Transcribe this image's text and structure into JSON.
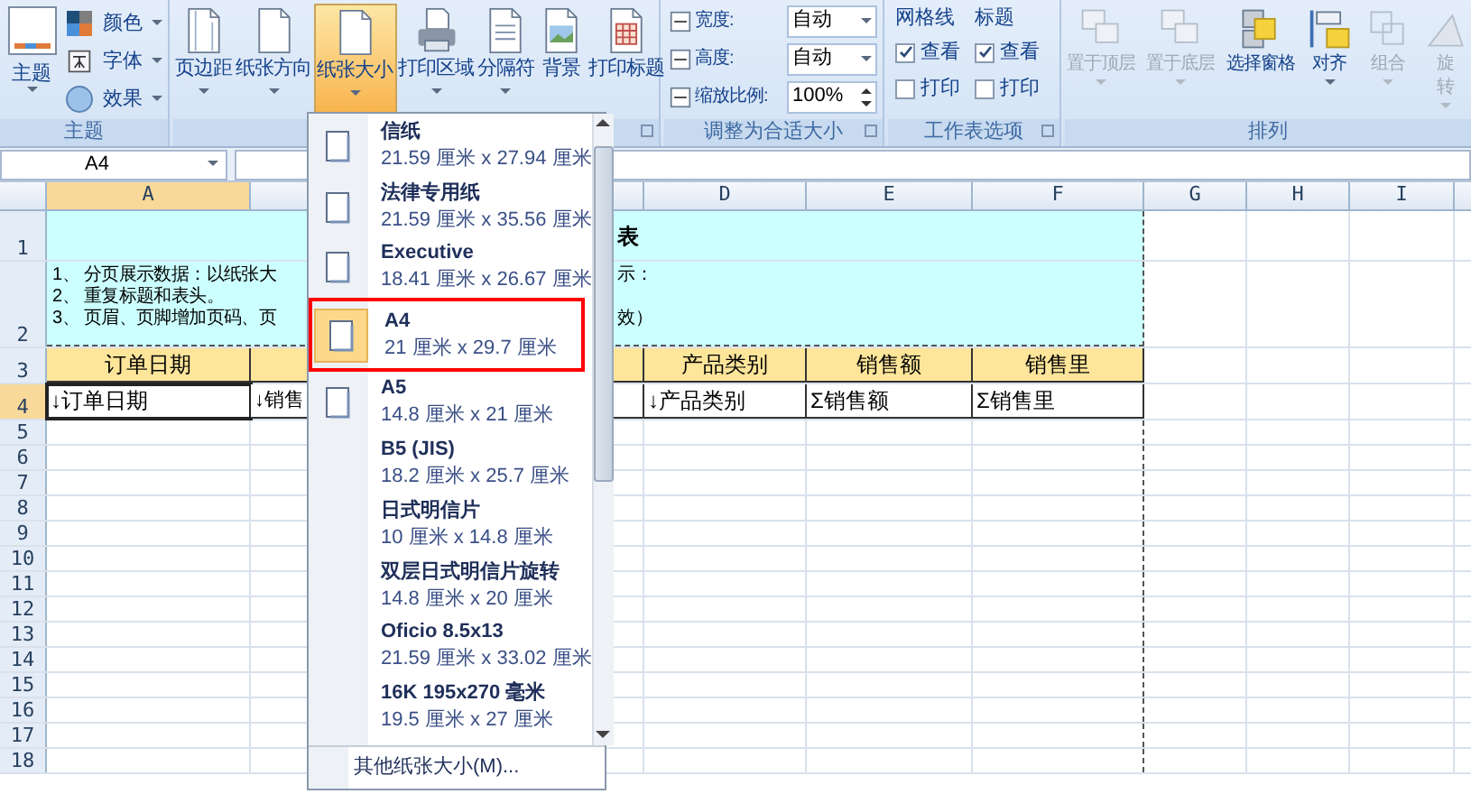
{
  "ribbon": {
    "theme_group": {
      "label": "主题",
      "button": "主题",
      "options": [
        "颜色",
        "字体",
        "效果"
      ]
    },
    "page_setup_group": {
      "buttons": [
        {
          "label": "页边距",
          "dropdown": true,
          "active": false
        },
        {
          "label": "纸张方向",
          "dropdown": true,
          "active": false
        },
        {
          "label": "纸张大小",
          "dropdown": true,
          "active": true
        },
        {
          "label": "打印区域",
          "dropdown": true,
          "active": false
        },
        {
          "label": "分隔符",
          "dropdown": true,
          "active": false
        },
        {
          "label": "背景",
          "dropdown": false,
          "active": false
        },
        {
          "label": "打印标题",
          "dropdown": false,
          "active": false
        }
      ]
    },
    "scale_group": {
      "label": "调整为合适大小",
      "fields": [
        {
          "label": "宽度:",
          "value": "自动",
          "kind": "dropdown"
        },
        {
          "label": "高度:",
          "value": "自动",
          "kind": "dropdown"
        },
        {
          "label": "缩放比例:",
          "value": "100%",
          "kind": "spinner"
        }
      ]
    },
    "sheet_options_group": {
      "label": "工作表选项",
      "sections": [
        {
          "title": "网格线",
          "options": [
            {
              "label": "查看",
              "checked": true
            },
            {
              "label": "打印",
              "checked": false
            }
          ]
        },
        {
          "title": "标题",
          "options": [
            {
              "label": "查看",
              "checked": true
            },
            {
              "label": "打印",
              "checked": false
            }
          ]
        }
      ]
    },
    "arrange_group": {
      "label": "排列",
      "buttons": [
        {
          "label": "置于顶层",
          "disabled": true,
          "dropdown": true
        },
        {
          "label": "置于底层",
          "disabled": true,
          "dropdown": true
        },
        {
          "label": "选择窗格",
          "disabled": false,
          "dropdown": false
        },
        {
          "label": "对齐",
          "disabled": false,
          "dropdown": true
        },
        {
          "label": "组合",
          "disabled": true,
          "dropdown": true
        },
        {
          "label": "旋转",
          "disabled": true,
          "dropdown": true
        }
      ]
    }
  },
  "name_box": "A4",
  "sheet": {
    "column_headers": [
      {
        "label": "A",
        "selected": true
      },
      {
        "label": "D",
        "selected": false
      },
      {
        "label": "E",
        "selected": false
      },
      {
        "label": "F",
        "selected": false
      },
      {
        "label": "G",
        "selected": false
      },
      {
        "label": "H",
        "selected": false
      },
      {
        "label": "I",
        "selected": false
      }
    ],
    "row_headers": [
      {
        "label": "1",
        "selected": false
      },
      {
        "label": "2",
        "selected": false
      },
      {
        "label": "3",
        "selected": false
      },
      {
        "label": "4",
        "selected": true
      },
      {
        "label": "5",
        "selected": false
      },
      {
        "label": "6",
        "selected": false
      },
      {
        "label": "7",
        "selected": false
      },
      {
        "label": "8",
        "selected": false
      },
      {
        "label": "9",
        "selected": false
      },
      {
        "label": "10",
        "selected": false
      },
      {
        "label": "11",
        "selected": false
      },
      {
        "label": "12",
        "selected": false
      },
      {
        "label": "13",
        "selected": false
      },
      {
        "label": "14",
        "selected": false
      },
      {
        "label": "15",
        "selected": false
      },
      {
        "label": "16",
        "selected": false
      },
      {
        "label": "17",
        "selected": false
      },
      {
        "label": "18",
        "selected": false
      }
    ],
    "title": "表",
    "notes": [
      "1、 分页展示数据：以纸张大",
      "2、 重复标题和表头。",
      "3、 页眉、页脚增加页码、页"
    ],
    "note_fragments": {
      "first": "示：",
      "third": "效）"
    },
    "header_row": {
      "a": "订单日期",
      "d": "产品类别",
      "e": "销售额",
      "f": "销售里"
    },
    "field_row": {
      "a": "↓订单日期",
      "b": "↓销售",
      "d": "↓产品类别",
      "e": "Σ销售额",
      "f": "Σ销售里"
    }
  },
  "paper_menu": {
    "items": [
      {
        "name": "信纸",
        "size": "21.59 厘米 x 27.94 厘米",
        "selected": false,
        "icon": true
      },
      {
        "name": "法律专用纸",
        "size": "21.59 厘米 x 35.56 厘米",
        "selected": false,
        "icon": true
      },
      {
        "name": "Executive",
        "size": "18.41 厘米 x 26.67 厘米",
        "selected": false,
        "icon": true
      },
      {
        "name": "A4",
        "size": "21 厘米 x 29.7 厘米",
        "selected": true,
        "icon": true
      },
      {
        "name": "A5",
        "size": "14.8 厘米 x 21 厘米",
        "selected": false,
        "icon": true
      },
      {
        "name": "B5 (JIS)",
        "size": "18.2 厘米 x 25.7 厘米",
        "selected": false,
        "icon": false
      },
      {
        "name": "日式明信片",
        "size": "10 厘米 x 14.8 厘米",
        "selected": false,
        "icon": false
      },
      {
        "name": "双层日式明信片旋转",
        "size": "14.8 厘米 x 20 厘米",
        "selected": false,
        "icon": false
      },
      {
        "name": "Oficio 8.5x13",
        "size": "21.59 厘米 x 33.02 厘米",
        "selected": false,
        "icon": false
      },
      {
        "name": "16K 195x270 毫米",
        "size": "19.5 厘米 x 27 厘米",
        "selected": false,
        "icon": false
      }
    ],
    "footer": "其他纸张大小(M)..."
  }
}
